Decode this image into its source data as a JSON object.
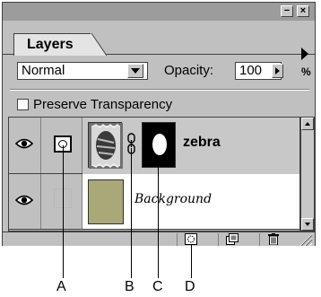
{
  "palette": {
    "titlebar": {
      "minimize_glyph": "−",
      "close_glyph": "×"
    },
    "tab": {
      "label": "Layers"
    },
    "menu_icon": "triangle-right-icon",
    "blend_mode": {
      "value": "Normal"
    },
    "opacity": {
      "label": "Opacity:",
      "value": "100",
      "unit": "%"
    },
    "preserve_transparency": {
      "label": "Preserve Transparency",
      "checked": false
    },
    "layers": [
      {
        "name": "zebra",
        "visible": true,
        "mask_active": true,
        "linked": true,
        "selected": true
      },
      {
        "name": "Background",
        "visible": true,
        "mask_active": false,
        "linked": false,
        "selected": false
      }
    ],
    "bottom_buttons": [
      "add-mask-icon",
      "new-layer-icon",
      "trash-icon"
    ]
  },
  "callouts": {
    "a": "A",
    "b": "B",
    "c": "C",
    "d": "D"
  },
  "colors": {
    "panel": "#c0c0c0",
    "titlebar": "#9c9c9c",
    "selected_row": "#c8c8c8",
    "background_thumb": "#a8a878"
  }
}
